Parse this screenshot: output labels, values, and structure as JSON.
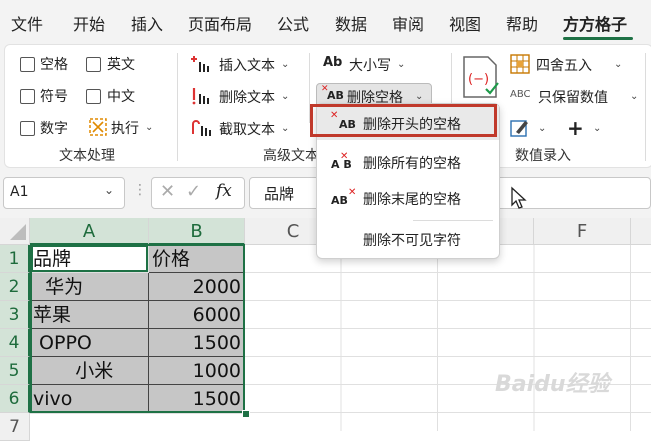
{
  "tabs": [
    "文件",
    "开始",
    "插入",
    "页面布局",
    "公式",
    "数据",
    "审阅",
    "视图",
    "帮助",
    "方方格子"
  ],
  "active_tab": "方方格子",
  "ribbon": {
    "text_processing": {
      "checkboxes": [
        "空格",
        "英文",
        "符号",
        "中文",
        "数字"
      ],
      "execute_label": "执行",
      "group_label": "文本处理"
    },
    "advanced_text": {
      "insert_text": "插入文本",
      "delete_text": "删除文本",
      "extract_text": "截取文本",
      "case_label": "大小写",
      "delete_spaces": "删除空格",
      "group_label": "高级文本"
    },
    "number_entry": {
      "value_label": "数值",
      "round_label": "四舍五入",
      "keep_values": "只保留数值",
      "abc_icon": "ABC",
      "group_label": "数值录入"
    }
  },
  "dropdown": {
    "items": [
      "删除开头的空格",
      "删除所有的空格",
      "删除末尾的空格",
      "删除不可见字符"
    ],
    "highlighted_index": 0
  },
  "formula_bar": {
    "name_box": "A1",
    "fx": "fx",
    "content": "品牌"
  },
  "columns": [
    "A",
    "B",
    "C",
    "D",
    "E",
    "F"
  ],
  "rows": [
    "1",
    "2",
    "3",
    "4",
    "5",
    "6",
    "7"
  ],
  "table": {
    "header": [
      "品牌",
      "价格"
    ],
    "rows": [
      {
        "brand": "  华为",
        "price": "2000"
      },
      {
        "brand": "苹果",
        "price": "6000"
      },
      {
        "brand": " OPPO",
        "price": "1500"
      },
      {
        "brand": "       小米",
        "price": "1000"
      },
      {
        "brand": "vivo",
        "price": "1500"
      }
    ]
  },
  "watermark": "Baidu经验",
  "colors": {
    "accent_green": "#1e7145",
    "highlight_red": "#c0392b",
    "selection_gray": "#c6c6c6"
  }
}
